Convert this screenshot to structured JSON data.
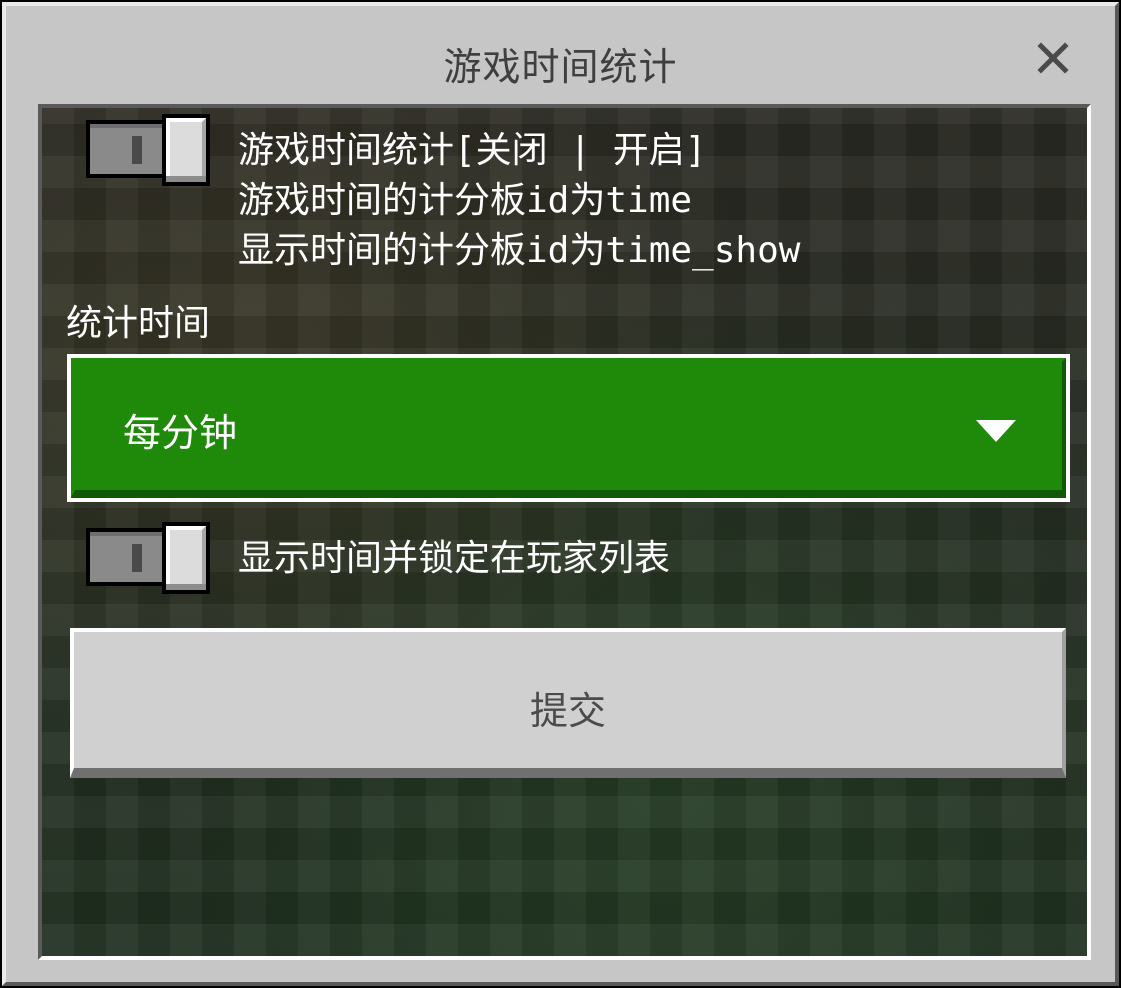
{
  "dialog": {
    "title": "游戏时间统计",
    "close_icon": "close-icon"
  },
  "toggle_game_time": {
    "label_line1": "游戏时间统计[关闭 | 开启]",
    "label_line2": "游戏时间的计分板id为time",
    "label_line3": "显示时间的计分板id为time_show",
    "state": "off"
  },
  "interval": {
    "label": "统计时间",
    "selected": "每分钟",
    "arrow_icon": "chevron-down-icon"
  },
  "toggle_show_list": {
    "label": "显示时间并锁定在玩家列表",
    "state": "off"
  },
  "submit": {
    "label": "提交"
  },
  "colors": {
    "dropdown_green": "#1f8a09",
    "panel_gray": "#c6c6c6"
  }
}
